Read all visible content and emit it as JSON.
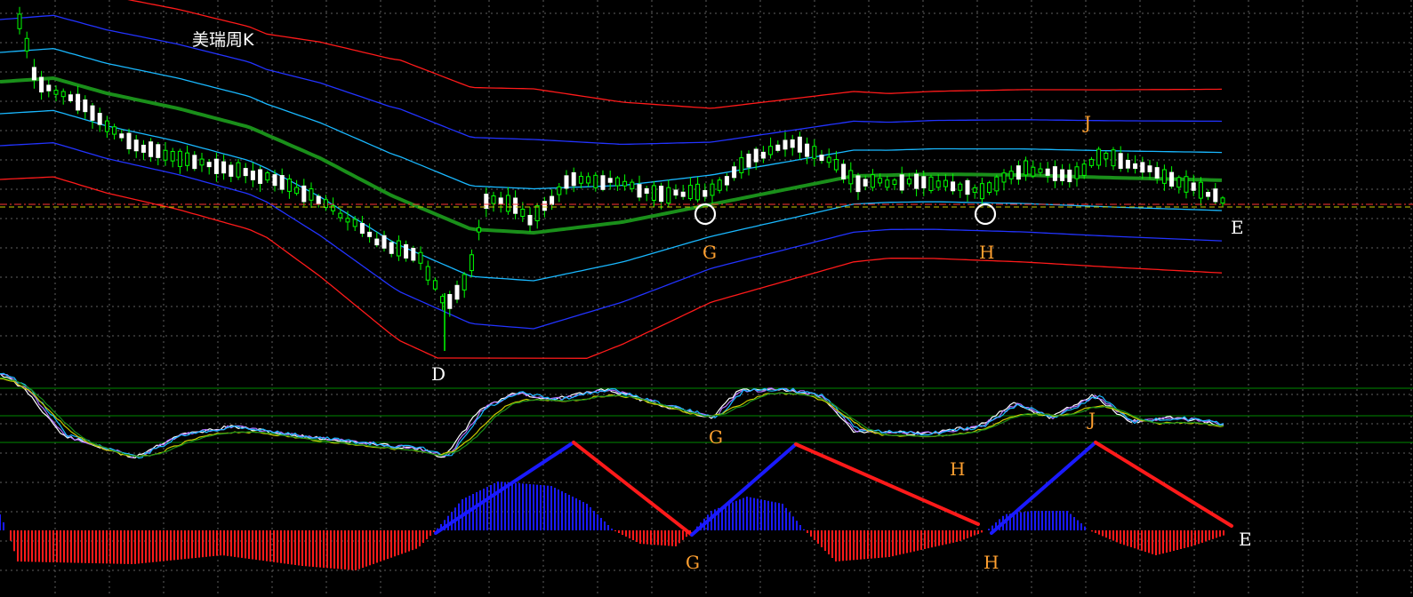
{
  "title": "美瑞周K",
  "colors": {
    "background": "#000000",
    "grid": "#5f5f5f",
    "candle": "#ffffff",
    "candle_wick": "#00ff00",
    "mid_band": "#1a8f1a",
    "inner_band": "#19b8ff",
    "middle_band": "#2233ff",
    "outer_band": "#ff1a1a",
    "price_line_red": "#ff3333",
    "price_line_yellow": "#cccc00",
    "osc_level": "#008800",
    "hist_up": "#1a1aff",
    "hist_down": "#ff1a1a",
    "label_orange": "#ffa030",
    "label_white": "#ffffff",
    "marker_circle": "#ffffff"
  },
  "price_panel": {
    "annotations": [
      {
        "text": "D",
        "color": "white"
      },
      {
        "text": "G",
        "color": "orange"
      },
      {
        "text": "H",
        "color": "orange"
      },
      {
        "text": "J",
        "color": "orange"
      },
      {
        "text": "E",
        "color": "white"
      }
    ],
    "markers": [
      "G",
      "H"
    ]
  },
  "oscillator_panel": {
    "annotations": [
      {
        "text": "G",
        "color": "orange"
      },
      {
        "text": "H",
        "color": "orange"
      },
      {
        "text": "J",
        "color": "orange"
      }
    ]
  },
  "histogram_panel": {
    "annotations": [
      {
        "text": "G",
        "color": "orange"
      },
      {
        "text": "H",
        "color": "orange"
      },
      {
        "text": "E",
        "color": "white"
      }
    ],
    "wave_pattern": [
      "rise",
      "fall",
      "rise",
      "fall",
      "rise",
      "fall"
    ]
  }
}
